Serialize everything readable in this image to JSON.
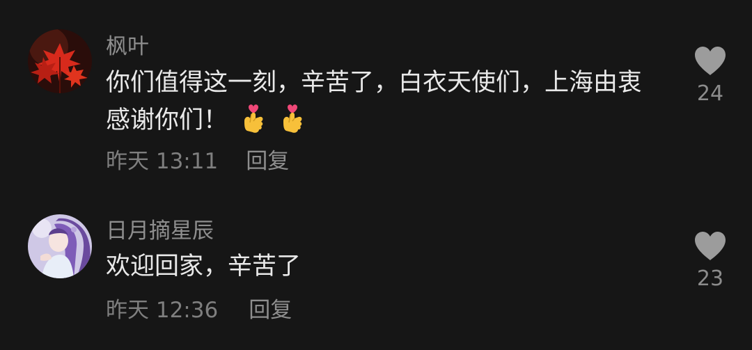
{
  "comments": [
    {
      "username": "枫叶",
      "text": "你们值得这一刻，辛苦了，白衣天使们，上海由衷感谢你们！",
      "emoji": [
        "finger-heart-icon",
        "finger-heart-icon"
      ],
      "time": "昨天 13:11",
      "reply_label": "回复",
      "likes": "24"
    },
    {
      "username": "日月摘星辰",
      "text": "欢迎回家，辛苦了",
      "time": "昨天 12:36",
      "reply_label": "回复",
      "likes": "23"
    }
  ],
  "colors": {
    "background": "#161616",
    "text_primary": "#e9e9e9",
    "text_secondary": "#8e8e8e",
    "like_icon": "#9c9c9c"
  }
}
